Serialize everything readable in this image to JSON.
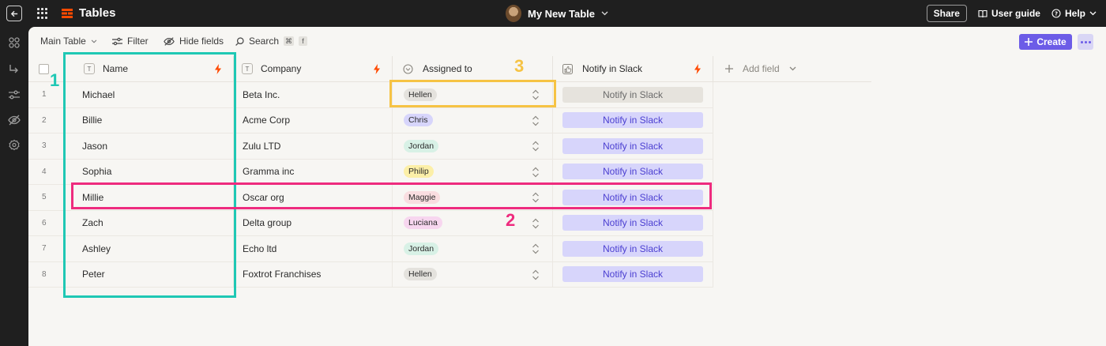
{
  "app": {
    "title": "Tables",
    "table_name": "My New Table"
  },
  "header_actions": {
    "share": "Share",
    "user_guide": "User guide",
    "help": "Help"
  },
  "toolbar": {
    "view": "Main Table",
    "filter": "Filter",
    "hide_fields": "Hide fields",
    "search": "Search",
    "search_key1": "⌘",
    "search_key2": "f",
    "create": "Create"
  },
  "columns": {
    "name": "Name",
    "company": "Company",
    "assigned": "Assigned to",
    "slack": "Notify in Slack",
    "add_field": "Add field"
  },
  "rows": [
    {
      "num": "1",
      "name": "Michael",
      "company": "Beta Inc.",
      "assigned": "Hellen",
      "slack": "Notify in Slack"
    },
    {
      "num": "2",
      "name": "Billie",
      "company": "Acme Corp",
      "assigned": "Chris",
      "slack": "Notify in Slack"
    },
    {
      "num": "3",
      "name": "Jason",
      "company": "Zulu LTD",
      "assigned": "Jordan",
      "slack": "Notify in Slack"
    },
    {
      "num": "4",
      "name": "Sophia",
      "company": "Gramma inc",
      "assigned": "Philip",
      "slack": "Notify in Slack"
    },
    {
      "num": "5",
      "name": "Millie",
      "company": "Oscar org",
      "assigned": "Maggie",
      "slack": "Notify in Slack"
    },
    {
      "num": "6",
      "name": "Zach",
      "company": "Delta group",
      "assigned": "Luciana",
      "slack": "Notify in Slack"
    },
    {
      "num": "7",
      "name": "Ashley",
      "company": "Echo ltd",
      "assigned": "Jordan",
      "slack": "Notify in Slack"
    },
    {
      "num": "8",
      "name": "Peter",
      "company": "Foxtrot Franchises",
      "assigned": "Hellen",
      "slack": "Notify in Slack"
    }
  ],
  "chip_colors": {
    "Hellen": "#e4e2dd",
    "Chris": "#d7d5fb",
    "Jordan": "#d8f1e6",
    "Philip": "#fcefa8",
    "Maggie": "#f9dde0",
    "Luciana": "#f7d6ef"
  },
  "annotations": [
    {
      "label": "1",
      "color": "#1fc8b4"
    },
    {
      "label": "2",
      "color": "#ee2b7e"
    },
    {
      "label": "3",
      "color": "#f6c344"
    }
  ],
  "colors": {
    "accent": "#6c5ce7",
    "bolt": "#ff4a00"
  }
}
